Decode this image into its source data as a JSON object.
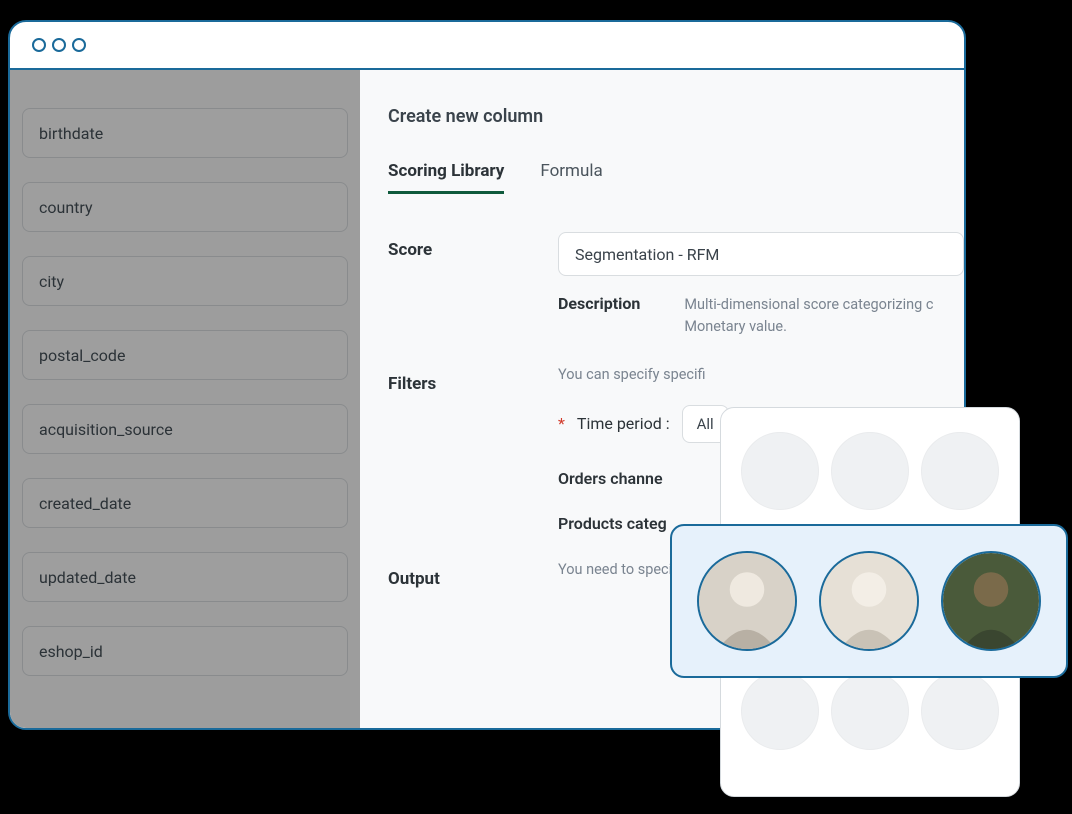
{
  "sidebar": {
    "fields": [
      "birthdate",
      "country",
      "city",
      "postal_code",
      "acquisition_source",
      "created_date",
      "updated_date",
      "eshop_id"
    ]
  },
  "main": {
    "title": "Create new column",
    "tabs": {
      "scoring": "Scoring Library",
      "formula": "Formula"
    },
    "score": {
      "label": "Score",
      "value": "Segmentation - RFM",
      "desc_label": "Description",
      "desc_text": "Multi-dimensional score categorizing c\nMonetary value."
    },
    "filters": {
      "label": "Filters",
      "help": "You can specify specifi",
      "time_label": "Time period :",
      "time_value": "All",
      "orders": "Orders channe",
      "products": "Products categ"
    },
    "output": {
      "label": "Output",
      "help": "You need to specify at"
    }
  }
}
